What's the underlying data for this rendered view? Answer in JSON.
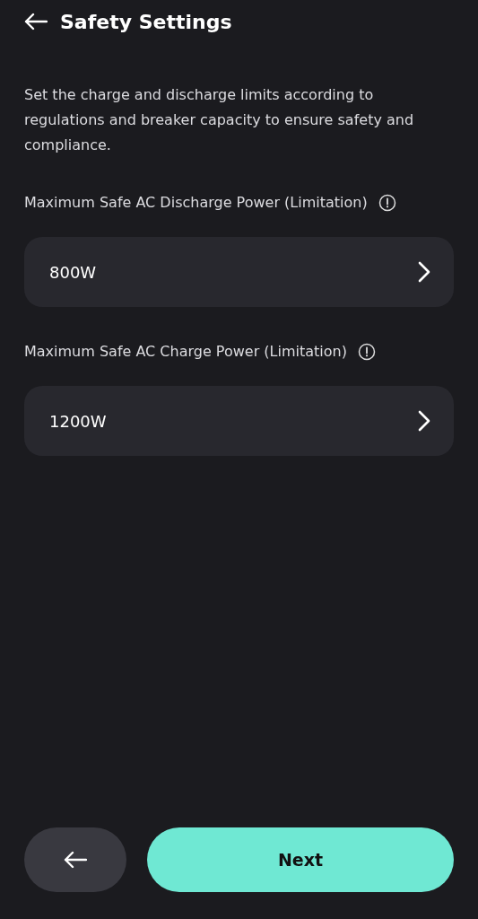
{
  "header": {
    "title": "Safety Settings"
  },
  "description": "Set the charge and discharge limits according to regulations and breaker capacity to ensure safety and compliance.",
  "settings": [
    {
      "label": "Maximum Safe AC Discharge Power (Limitation)",
      "value": "800W"
    },
    {
      "label": "Maximum Safe AC Charge Power (Limitation)",
      "value": "1200W"
    }
  ],
  "footer": {
    "next_label": "Next"
  }
}
